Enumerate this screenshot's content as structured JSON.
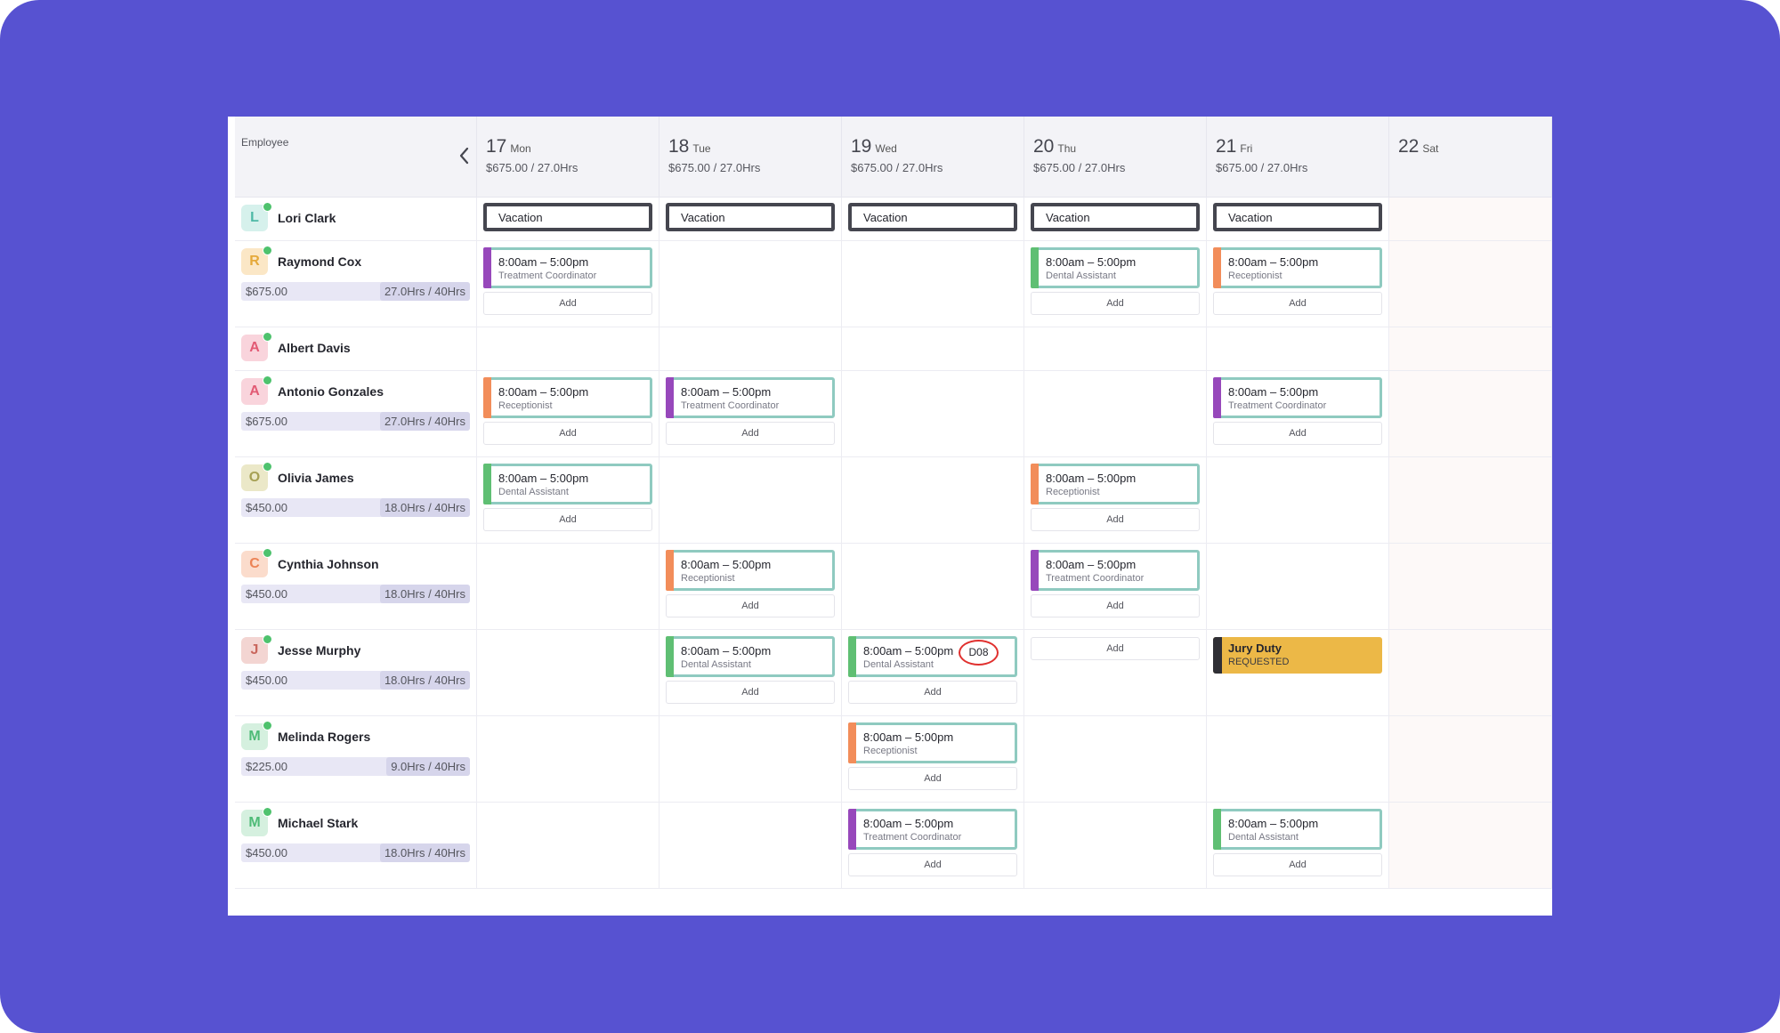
{
  "colors": {
    "frame": "#5752d1",
    "role_treatment_coordinator": "#9748bb",
    "role_dental_assistant": "#5fbf73",
    "role_receptionist": "#f28d5a",
    "shift_border": "#8fcac0",
    "vacation_border": "#45464f",
    "jury_duty": "#ecb847",
    "badge_circle": "#e0302e"
  },
  "header": {
    "employee_label": "Employee",
    "back_icon": "chevron-left-icon",
    "days": [
      {
        "num": "17",
        "name": "Mon",
        "stats": "$675.00 / 27.0Hrs"
      },
      {
        "num": "18",
        "name": "Tue",
        "stats": "$675.00 / 27.0Hrs"
      },
      {
        "num": "19",
        "name": "Wed",
        "stats": "$675.00 / 27.0Hrs"
      },
      {
        "num": "20",
        "name": "Thu",
        "stats": "$675.00 / 27.0Hrs"
      },
      {
        "num": "21",
        "name": "Fri",
        "stats": "$675.00 / 27.0Hrs"
      },
      {
        "num": "22",
        "name": "Sat",
        "stats": ""
      }
    ]
  },
  "labels": {
    "add": "Add",
    "vacation": "Vacation",
    "jury_title": "Jury Duty",
    "jury_status": "REQUESTED",
    "badge": "D08",
    "shift_time": "8:00am – 5:00pm",
    "role_tc": "Treatment Coordinator",
    "role_da": "Dental Assistant",
    "role_rec": "Receptionist"
  },
  "employees": [
    {
      "initial": "L",
      "name": "Lori Clark",
      "pay": "",
      "hours": "",
      "avatar_bg": "#d6f1ec",
      "avatar_fg": "#4db9a6"
    },
    {
      "initial": "R",
      "name": "Raymond Cox",
      "pay": "$675.00",
      "hours": "27.0Hrs / 40Hrs",
      "avatar_bg": "#fbe7c6",
      "avatar_fg": "#e5a93a"
    },
    {
      "initial": "A",
      "name": "Albert Davis",
      "pay": "",
      "hours": "",
      "avatar_bg": "#f9d4dc",
      "avatar_fg": "#e25a74"
    },
    {
      "initial": "A",
      "name": "Antonio Gonzales",
      "pay": "$675.00",
      "hours": "27.0Hrs / 40Hrs",
      "avatar_bg": "#f9d4dc",
      "avatar_fg": "#e25a74"
    },
    {
      "initial": "O",
      "name": "Olivia James",
      "pay": "$450.00",
      "hours": "18.0Hrs / 40Hrs",
      "avatar_bg": "#ebe8c8",
      "avatar_fg": "#a6a054"
    },
    {
      "initial": "C",
      "name": "Cynthia Johnson",
      "pay": "$450.00",
      "hours": "18.0Hrs / 40Hrs",
      "avatar_bg": "#fbdccc",
      "avatar_fg": "#ec8356"
    },
    {
      "initial": "J",
      "name": "Jesse Murphy",
      "pay": "$450.00",
      "hours": "18.0Hrs / 40Hrs",
      "avatar_bg": "#f3d5d2",
      "avatar_fg": "#c9665c"
    },
    {
      "initial": "M",
      "name": "Melinda Rogers",
      "pay": "$225.00",
      "hours": "9.0Hrs / 40Hrs",
      "avatar_bg": "#d5f0df",
      "avatar_fg": "#4ebb77"
    },
    {
      "initial": "M",
      "name": "Michael Stark",
      "pay": "$450.00",
      "hours": "18.0Hrs / 40Hrs",
      "avatar_bg": "#d5f0df",
      "avatar_fg": "#4ebb77"
    }
  ],
  "schedule": [
    [
      {
        "type": "vacation"
      },
      {
        "type": "vacation"
      },
      {
        "type": "vacation"
      },
      {
        "type": "vacation"
      },
      {
        "type": "vacation"
      },
      null
    ],
    [
      {
        "type": "shift",
        "role": "tc"
      },
      null,
      null,
      {
        "type": "shift",
        "role": "da"
      },
      {
        "type": "shift",
        "role": "rec"
      },
      null
    ],
    [
      null,
      null,
      null,
      null,
      null,
      null
    ],
    [
      {
        "type": "shift",
        "role": "rec"
      },
      {
        "type": "shift",
        "role": "tc"
      },
      null,
      null,
      {
        "type": "shift",
        "role": "tc"
      },
      null
    ],
    [
      {
        "type": "shift",
        "role": "da"
      },
      null,
      null,
      {
        "type": "shift",
        "role": "rec"
      },
      null,
      null
    ],
    [
      null,
      {
        "type": "shift",
        "role": "rec"
      },
      null,
      {
        "type": "shift",
        "role": "tc"
      },
      null,
      null
    ],
    [
      null,
      {
        "type": "shift",
        "role": "da"
      },
      {
        "type": "shift",
        "role": "da",
        "badge": true
      },
      {
        "type": "add"
      },
      {
        "type": "jury"
      },
      null
    ],
    [
      null,
      null,
      {
        "type": "shift",
        "role": "rec"
      },
      null,
      null,
      null
    ],
    [
      null,
      null,
      {
        "type": "shift",
        "role": "tc"
      },
      null,
      {
        "type": "shift",
        "role": "da"
      },
      null
    ]
  ]
}
